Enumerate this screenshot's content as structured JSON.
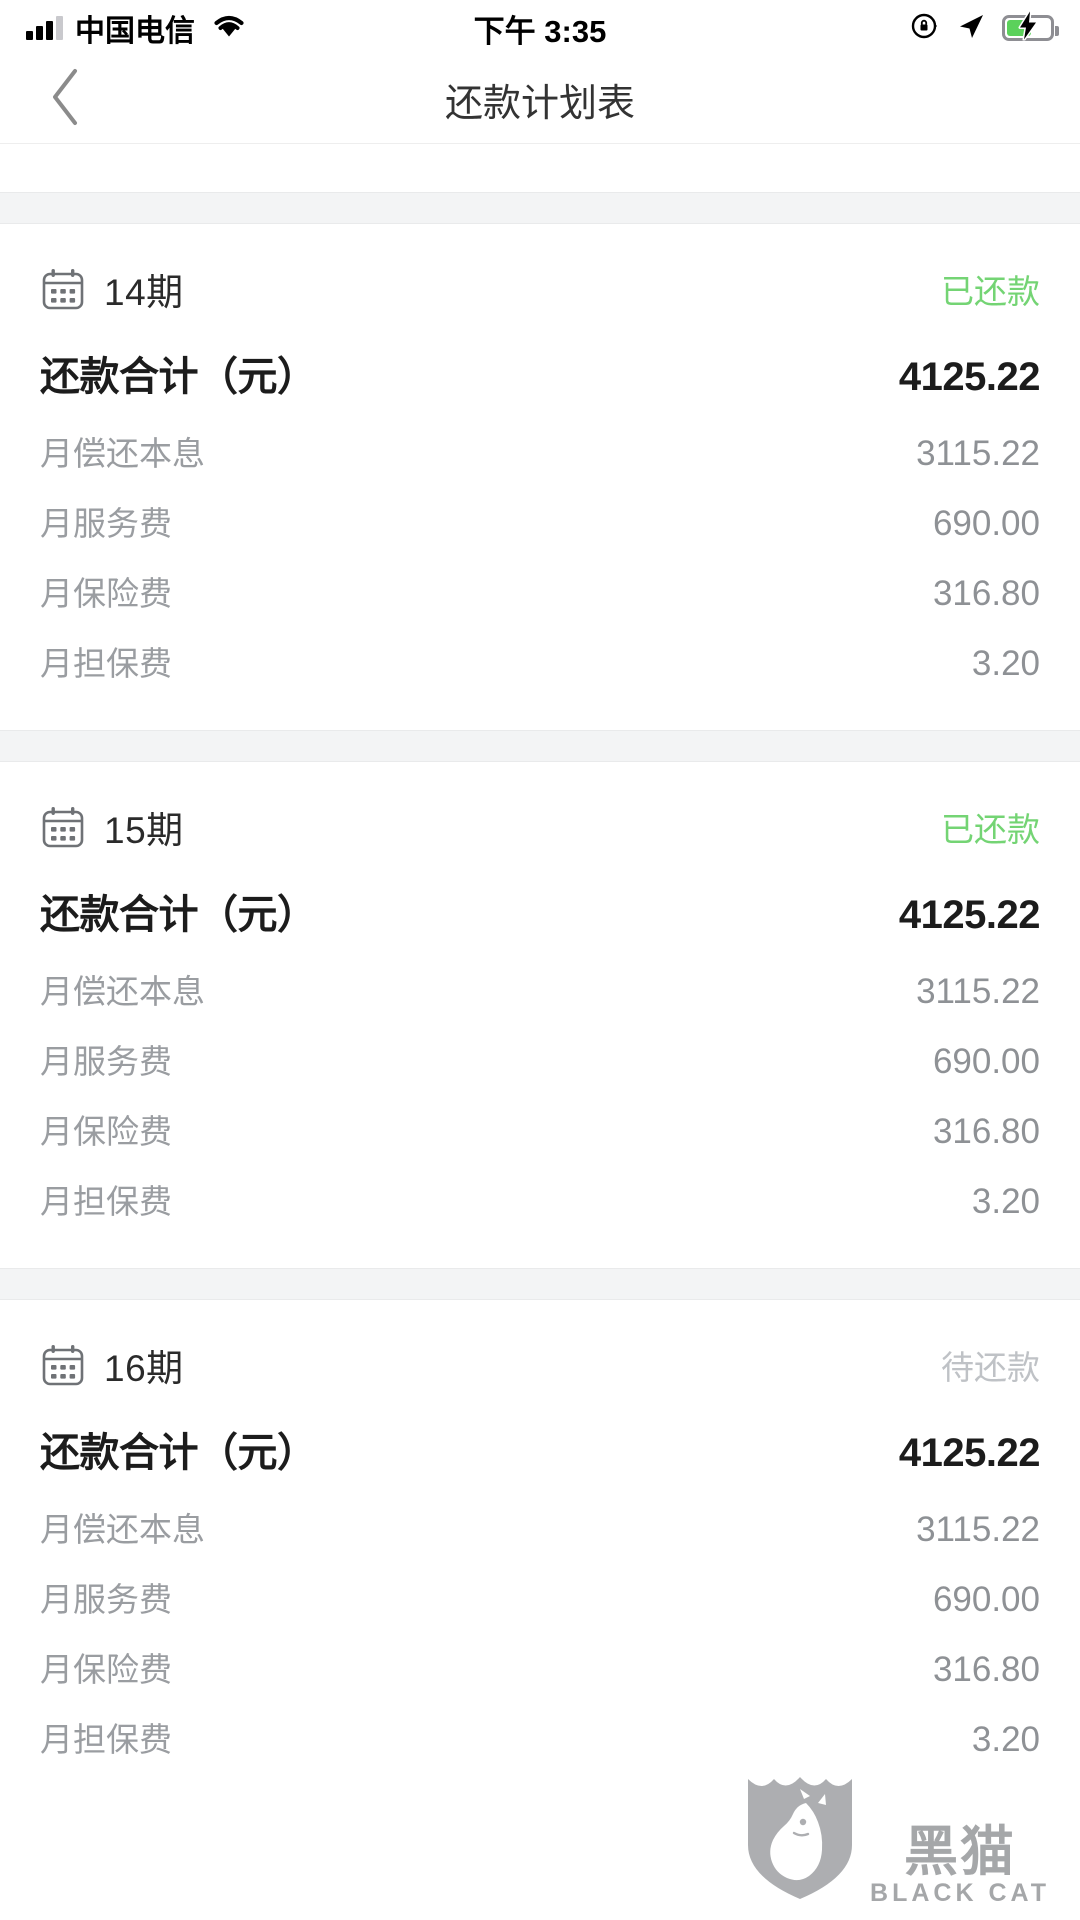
{
  "statusbar": {
    "carrier": "中国电信",
    "time": "下午 3:35",
    "signal_icon": "signal-bars-icon",
    "wifi_icon": "wifi-icon",
    "rotation_lock_icon": "rotation-lock-icon",
    "location_icon": "location-arrow-icon",
    "battery_icon": "battery-charging-icon",
    "battery_level_percent": 58,
    "battery_color": "#5bd15b"
  },
  "navbar": {
    "back_icon": "chevron-left-icon",
    "title": "还款计划表"
  },
  "colors": {
    "paid_green": "#74d474",
    "due_gray": "#bfc2c6",
    "band_gray": "#f3f4f5",
    "primary_text": "#1c1c1c",
    "secondary_text": "#9a9da1"
  },
  "labels": {
    "total": "还款合计（元）",
    "principal_interest": "月偿还本息",
    "service_fee": "月服务费",
    "insurance_fee": "月保险费",
    "guarantee_fee": "月担保费",
    "calendar_icon": "calendar-icon"
  },
  "cards": [
    {
      "period": "14期",
      "status": "已还款",
      "status_type": "paid",
      "total": "4125.22",
      "principal_interest": "3115.22",
      "service_fee": "690.00",
      "insurance_fee": "316.80",
      "guarantee_fee": "3.20"
    },
    {
      "period": "15期",
      "status": "已还款",
      "status_type": "paid",
      "total": "4125.22",
      "principal_interest": "3115.22",
      "service_fee": "690.00",
      "insurance_fee": "316.80",
      "guarantee_fee": "3.20"
    },
    {
      "period": "16期",
      "status": "待还款",
      "status_type": "due",
      "total": "4125.22",
      "principal_interest": "3115.22",
      "service_fee": "690.00",
      "insurance_fee": "316.80",
      "guarantee_fee": "3.20"
    }
  ],
  "watermark": {
    "shield_icon": "black-cat-shield-logo",
    "name_cn": "黑猫",
    "name_en": "BLACK CAT"
  }
}
